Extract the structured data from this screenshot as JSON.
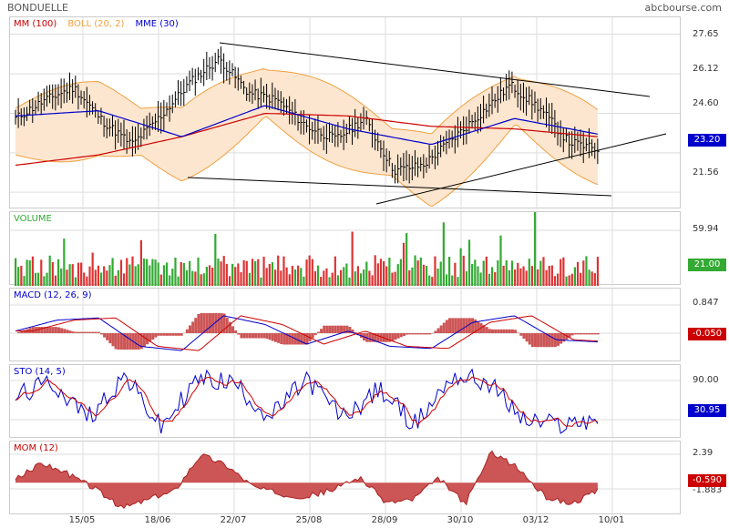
{
  "header": {
    "title": "BONDUELLE",
    "brand": "abcbourse.com"
  },
  "colors": {
    "price": "#000000",
    "mm": "#cc0000",
    "boll": "#f0a040",
    "bollfill": "#fde6cf",
    "mme": "#0000cc",
    "up": "#33aa33",
    "down": "#dd3333",
    "macd": "#0000cc",
    "signal": "#cc0000",
    "hist": "#cc5555",
    "grid": "#dddddd"
  },
  "xaxis": {
    "labels": [
      "15/05",
      "18/06",
      "22/07",
      "25/08",
      "28/09",
      "30/10",
      "03/12",
      "10/01"
    ]
  },
  "panels": {
    "price": {
      "legend": [
        {
          "text": "MM (100)",
          "color": "#cc0000"
        },
        {
          "text": "BOLL (20, 2)",
          "color": "#f0a040"
        },
        {
          "text": "MME (30)",
          "color": "#0000cc"
        }
      ],
      "yticks": [
        "27.65",
        "26.12",
        "24.60",
        "23.08",
        "21.56"
      ],
      "last": "23.20",
      "last_color": "#0000cc"
    },
    "volume": {
      "legend": [
        {
          "text": "VOLUME",
          "color": "#33aa33"
        }
      ],
      "yticks": [
        "59.94"
      ],
      "last": "21.00",
      "last_color": "#33aa33"
    },
    "macd": {
      "legend": [
        {
          "text": "MACD (12, 26, 9)",
          "color": "#0000cc"
        }
      ],
      "yticks": [
        "0.847"
      ],
      "last": "-0.050",
      "last_color": "#cc0000"
    },
    "sto": {
      "legend": [
        {
          "text": "STO (14, 5)",
          "color": "#0000cc"
        }
      ],
      "yticks": [
        "90.00"
      ],
      "last": "30.95",
      "last_color": "#0000cc"
    },
    "mom": {
      "legend": [
        {
          "text": "MOM (12)",
          "color": "#cc0000"
        }
      ],
      "yticks": [
        "2.39",
        "-1.883"
      ],
      "last": "-0.590",
      "last_color": "#cc0000"
    }
  },
  "chart_data": [
    {
      "type": "line",
      "name": "price",
      "x": [
        "15/05",
        "18/06",
        "22/07",
        "25/08",
        "28/09",
        "30/10",
        "03/12",
        "10/01"
      ],
      "ylim": [
        20.9,
        28.3
      ],
      "series": [
        {
          "name": "MM (100)",
          "values": [
            22.6,
            23.0,
            23.7,
            24.6,
            24.5,
            24.1,
            24.0,
            23.7
          ]
        },
        {
          "name": "MME (30)",
          "values": [
            24.5,
            24.7,
            23.7,
            24.9,
            24.0,
            23.4,
            24.4,
            23.8
          ]
        },
        {
          "name": "BOLL (20, 2)",
          "values": [
            23.9,
            24.4,
            23.4,
            25.4,
            23.9,
            22.4,
            25.1,
            23.3
          ]
        }
      ],
      "close": [
        24.4,
        25.1,
        25.6,
        24.3,
        23.4,
        24.5,
        25.8,
        26.7,
        25.4,
        25.1,
        24.1,
        23.6,
        24.4,
        22.4,
        22.6,
        23.6,
        24.6,
        25.7,
        24.8,
        23.5,
        23.2
      ],
      "last": 23.2
    },
    {
      "type": "bar",
      "name": "volume",
      "ylim": [
        0,
        72
      ],
      "last": 21.0
    },
    {
      "type": "line",
      "name": "macd",
      "ylim": [
        -1.2,
        1.2
      ],
      "last": -0.05
    },
    {
      "type": "line",
      "name": "sto",
      "ylim": [
        0,
        105
      ],
      "last": 30.95
    },
    {
      "type": "area",
      "name": "mom",
      "ylim": [
        -2.3,
        2.9
      ],
      "last": -0.59
    }
  ]
}
